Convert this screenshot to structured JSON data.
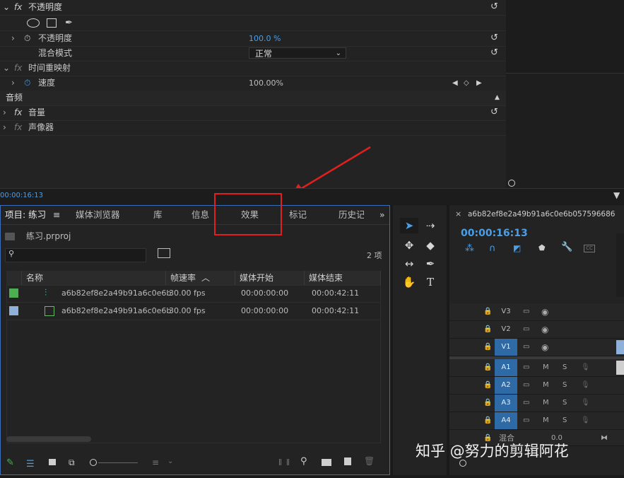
{
  "effect_controls": {
    "rows": [
      {
        "label": "不透明度"
      },
      {
        "label": "不透明度",
        "value": "100.0 %"
      },
      {
        "label": "混合模式",
        "value": "正常"
      },
      {
        "label": "时间重映射"
      },
      {
        "label": "速度",
        "value": "100.00%"
      },
      {
        "label": "音频"
      },
      {
        "label": "音量"
      },
      {
        "label": "声像器"
      }
    ],
    "fx_label": "fx",
    "timecode": "00:00:16:13"
  },
  "project_panel": {
    "tabs": [
      "项目: 练习",
      "媒体浏览器",
      "库",
      "信息",
      "效果",
      "标记",
      "历史记"
    ],
    "file_name": "练习.prproj",
    "search_placeholder": "",
    "item_count": "2 项",
    "columns": [
      "名称",
      "帧速率",
      "媒体开始",
      "媒体结束"
    ],
    "rows": [
      {
        "name": "a6b82ef8e2a49b91a6c0e6b",
        "fps": "30.00 fps",
        "start": "00:00:00:00",
        "end": "00:00:42:11",
        "color": "#4caf50"
      },
      {
        "name": "a6b82ef8e2a49b91a6c0e6b",
        "fps": "30.00 fps",
        "start": "00:00:00:00",
        "end": "00:00:42:11",
        "color": "#8fb0d8"
      }
    ]
  },
  "timeline": {
    "sequence_name": "a6b82ef8e2a49b91a6c0e6b057596686",
    "timecode": "00:00:16:13",
    "video_tracks": [
      "V3",
      "V2",
      "V1"
    ],
    "audio_tracks": [
      "A1",
      "A2",
      "A3",
      "A4"
    ],
    "mix_label": "混合",
    "mix_value": "0.0",
    "m_label": "M",
    "s_label": "S"
  },
  "watermark": "知乎 @努力的剪辑阿花",
  "colors": {
    "accent_blue": "#4a9fe8",
    "highlight_red": "#e02020",
    "track_blue": "#2d6aa6"
  }
}
